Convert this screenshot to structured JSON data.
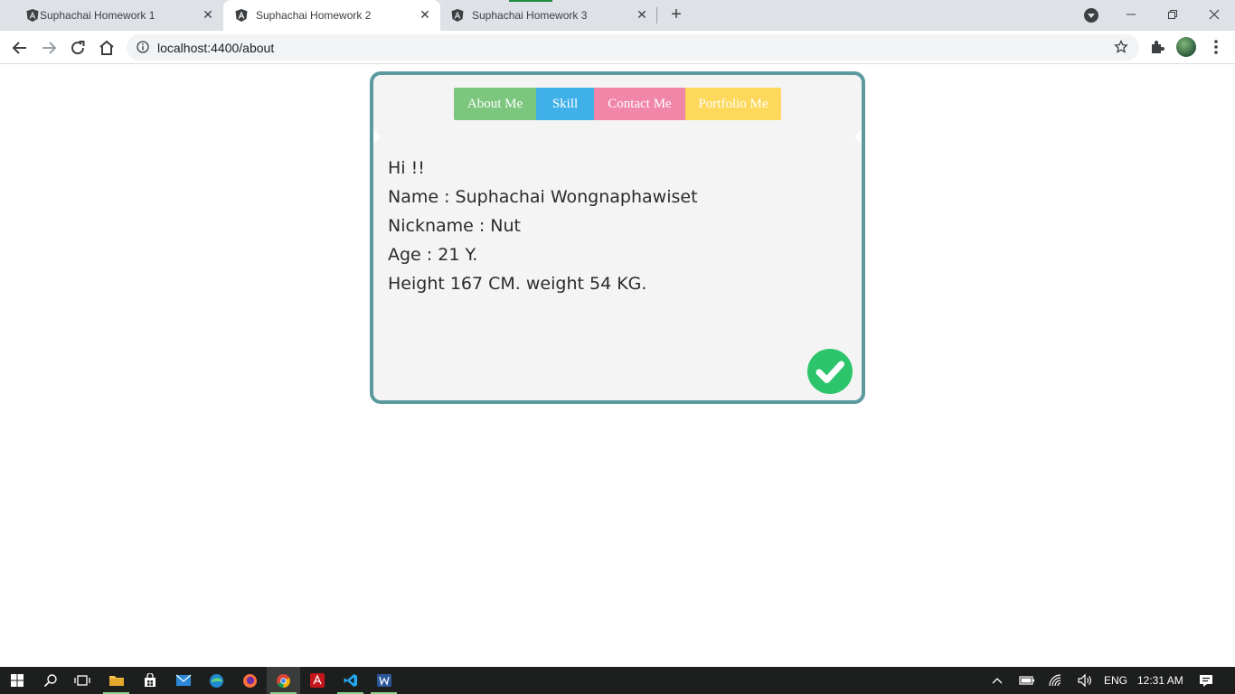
{
  "browser": {
    "tabs": [
      {
        "title": "Suphachai Homework 1",
        "active": false
      },
      {
        "title": "Suphachai Homework 2",
        "active": true
      },
      {
        "title": "Suphachai Homework 3",
        "active": false
      }
    ],
    "url": "localhost:4400/about"
  },
  "page": {
    "nav": {
      "about": "About Me",
      "skill": "Skill",
      "contact": "Contact Me",
      "portfolio": "Portfolio Me"
    },
    "info": {
      "greeting": "Hi !!",
      "name": "Name : Suphachai Wongnaphawiset",
      "nickname": "Nickname : Nut",
      "age": "Age : 21 Y.",
      "body": "Height 167 CM. weight 54 KG."
    },
    "colors": {
      "card_border": "#5c9a9e",
      "about": "#7cc67d",
      "skill": "#3fb1e8",
      "contact": "#f086a8",
      "portfolio": "#fed85a",
      "check": "#2dc56b"
    }
  },
  "taskbar": {
    "language": "ENG",
    "time": "12:31 AM"
  }
}
